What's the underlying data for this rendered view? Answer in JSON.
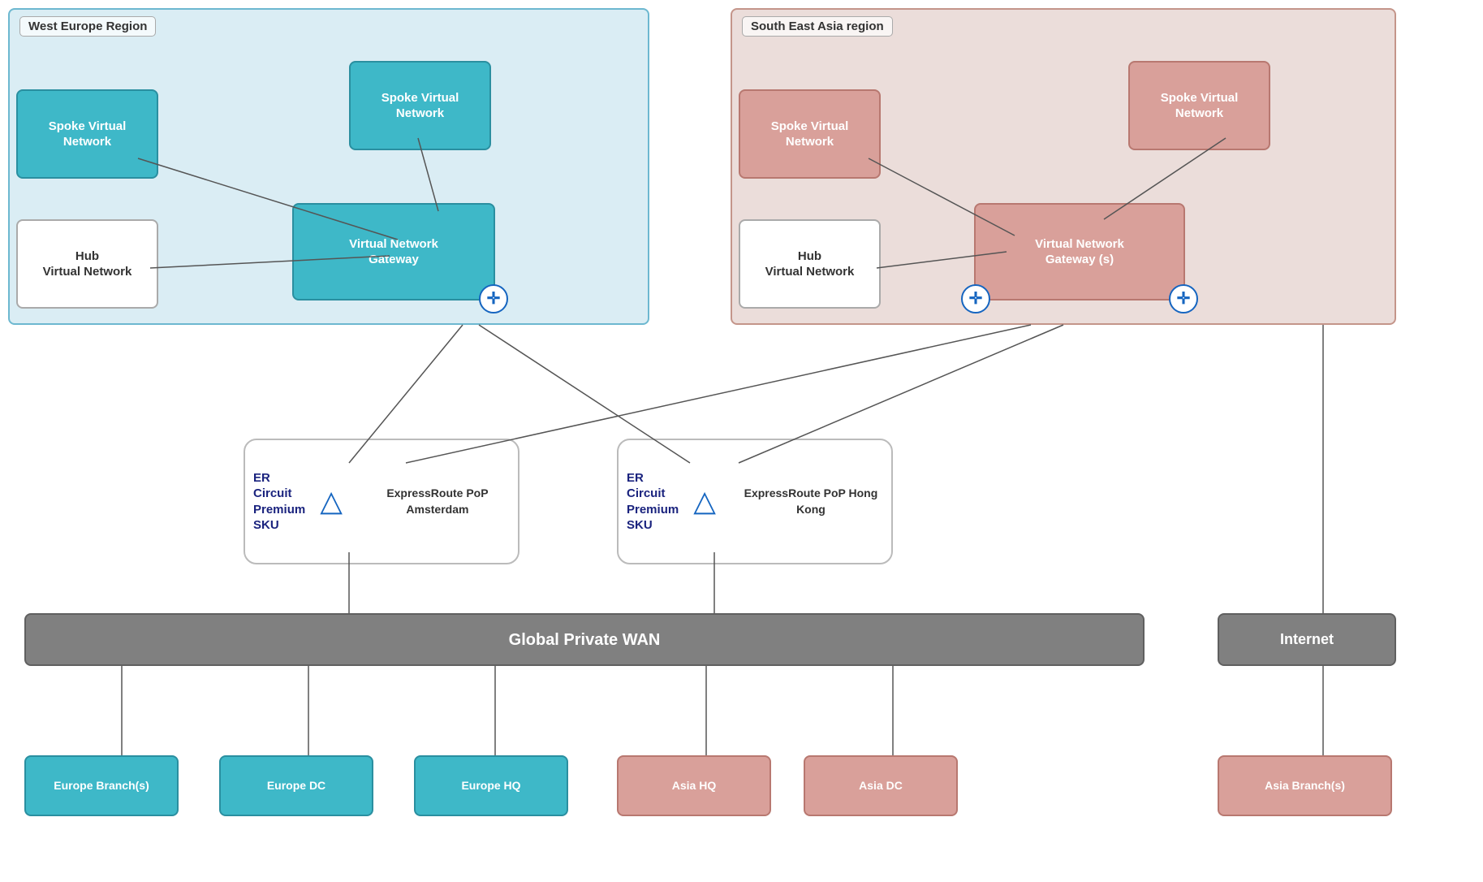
{
  "regions": [
    {
      "id": "west",
      "label": "West Europe Region"
    },
    {
      "id": "sea",
      "label": "South East Asia region"
    }
  ],
  "nodes": {
    "spoke_vn_west_left": "Spoke Virtual\nNetwork",
    "spoke_vn_west_right": "Spoke Virtual\nNetwork",
    "hub_vn_west": "Hub\nVirtual Network",
    "vng_west": "Virtual Network\nGateway",
    "spoke_vn_sea_left": "Spoke Virtual\nNetwork",
    "spoke_vn_sea_right": "Spoke Virtual\nNetwork",
    "hub_vn_sea": "Hub\nVirtual Network",
    "vng_sea": "Virtual Network\nGateway (s)",
    "er_circuit_amsterdam": "ER Circuit\nPremium\nSKU",
    "er_pop_amsterdam": "ExpressRoute\nPoP\nAmsterdam",
    "er_circuit_hongkong": "ER Circuit\nPremium\nSKU",
    "er_pop_hongkong": "ExpressRoute\nPoP\nHong Kong",
    "global_wan": "Global Private WAN",
    "internet": "Internet",
    "europe_branch": "Europe Branch(s)",
    "europe_dc": "Europe DC",
    "europe_hq": "Europe HQ",
    "asia_hq": "Asia HQ",
    "asia_dc": "Asia DC",
    "asia_branch": "Asia Branch(s)"
  },
  "icons": {
    "gateway": "⊕",
    "triangle": "△"
  }
}
